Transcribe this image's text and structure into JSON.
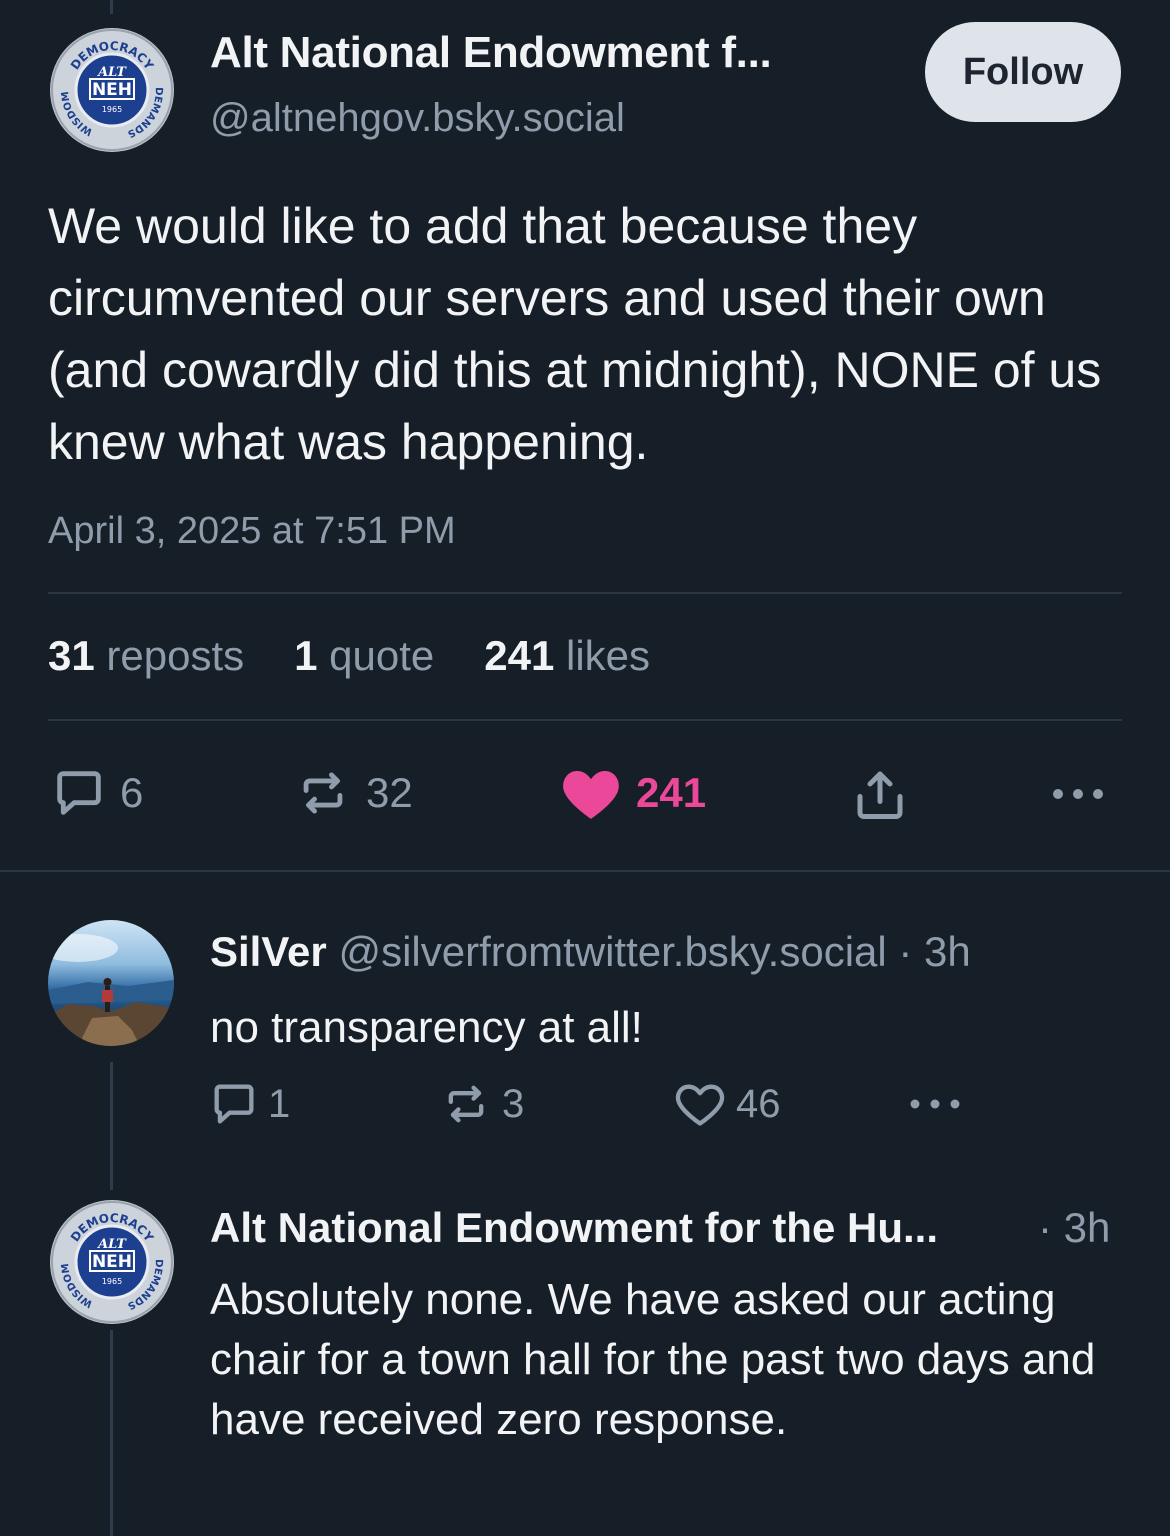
{
  "post": {
    "author_name": "Alt National Endowment f...",
    "author_handle": "@altnehgov.bsky.social",
    "follow_label": "Follow",
    "avatar": {
      "ring_text_top": "DEMOCRACY",
      "ring_text_left": "WISDOM",
      "ring_text_right": "DEMANDS",
      "center_top": "ALT",
      "center": "NEH",
      "year": "1965"
    },
    "text": "We would like to add that because they circumvented our servers and used their own (and cowardly did this at midnight), NONE of us knew what was happening.",
    "timestamp": "April 3, 2025 at 7:51 PM",
    "stats": {
      "reposts_count": "31",
      "reposts_label": "reposts",
      "quotes_count": "1",
      "quotes_label": "quote",
      "likes_count": "241",
      "likes_label": "likes"
    },
    "actions": {
      "replies": "6",
      "reposts": "32",
      "likes": "241",
      "reply_icon": "comment-icon",
      "repost_icon": "repost-icon",
      "like_icon": "heart-filled-icon",
      "share_icon": "share-icon",
      "more_icon": "more-icon",
      "like_color": "#ec4899"
    }
  },
  "replies": [
    {
      "name": "SilVer",
      "handle": "@silverfromtwitter.bsky.social",
      "time": "· 3h",
      "text": "no transparency at all!",
      "replies": "1",
      "reposts": "3",
      "likes": "46"
    },
    {
      "name": "Alt National Endowment for the Hu...",
      "time": "· 3h",
      "text": "Absolutely none. We have asked our acting chair for a town hall for the past two days and have received zero response."
    }
  ],
  "colors": {
    "background": "#161e27",
    "text": "#f1f3f5",
    "muted": "#8f9cab",
    "like": "#ec4899",
    "follow_bg": "#dfe4ea"
  }
}
